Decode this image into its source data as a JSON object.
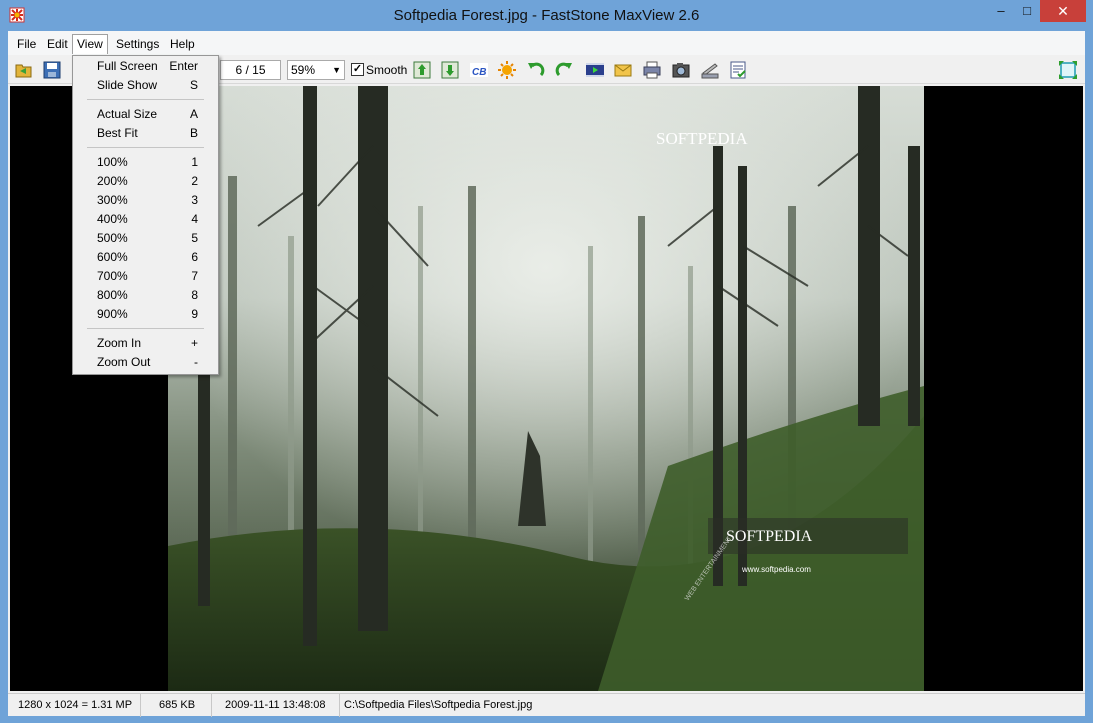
{
  "window": {
    "title": "Softpedia Forest.jpg - FastStone MaxView 2.6",
    "minimize": "–",
    "maximize": "□",
    "close": "✕"
  },
  "menu": {
    "items": [
      "File",
      "Edit",
      "View",
      "Settings",
      "Help"
    ],
    "active": "View"
  },
  "toolbar": {
    "page_indicator": "6 / 15",
    "zoom_value": "59%",
    "smooth_label": "Smooth",
    "smooth_checked": "✓"
  },
  "view_menu": {
    "groups": [
      [
        {
          "label": "Full Screen",
          "key": "Enter"
        },
        {
          "label": "Slide Show",
          "key": "S"
        }
      ],
      [
        {
          "label": "Actual Size",
          "key": "A"
        },
        {
          "label": "Best Fit",
          "key": "B"
        }
      ],
      [
        {
          "label": "100%",
          "key": "1"
        },
        {
          "label": "200%",
          "key": "2"
        },
        {
          "label": "300%",
          "key": "3"
        },
        {
          "label": "400%",
          "key": "4"
        },
        {
          "label": "500%",
          "key": "5"
        },
        {
          "label": "600%",
          "key": "6"
        },
        {
          "label": "700%",
          "key": "7"
        },
        {
          "label": "800%",
          "key": "8"
        },
        {
          "label": "900%",
          "key": "9"
        }
      ],
      [
        {
          "label": "Zoom In",
          "key": "+"
        },
        {
          "label": "Zoom Out",
          "key": "-"
        }
      ]
    ]
  },
  "image": {
    "watermark_top": "SOFTPEDIA",
    "watermark_mid": "SOFTPEDIA",
    "watermark_url": "www.softpedia.com",
    "watermark_side": "WEB ENTERTAINMENT"
  },
  "status": {
    "dimensions": "1280 x 1024 = 1.31 MP",
    "filesize": "685 KB",
    "datetime": "2009-11-11 13:48:08",
    "path": "C:\\Softpedia Files\\Softpedia Forest.jpg"
  }
}
